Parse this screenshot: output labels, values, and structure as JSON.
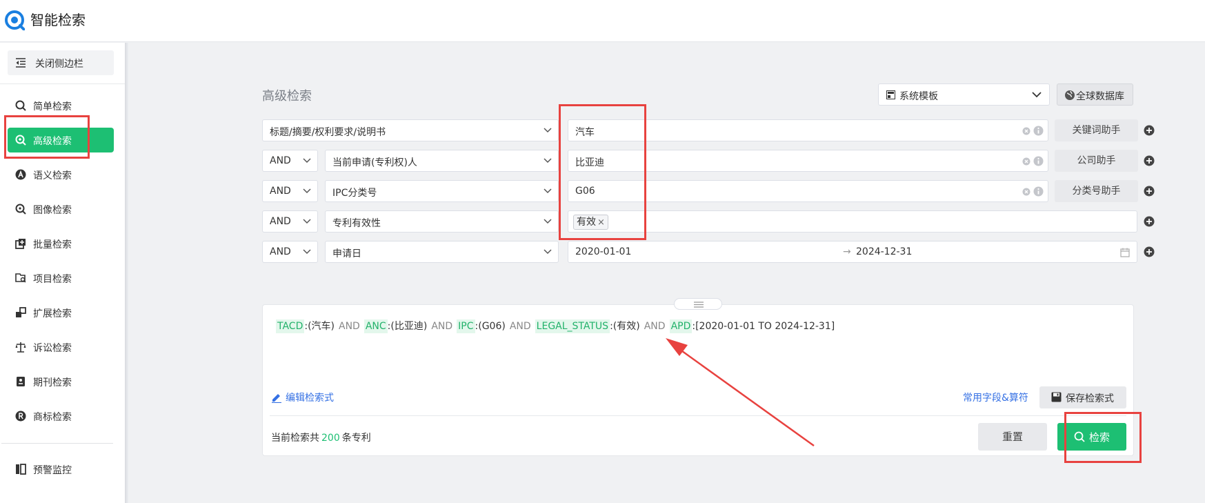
{
  "header": {
    "app_title": "智能检索",
    "logo_icon": "magnifier-logo-icon",
    "brand_color": "#1a7fe0"
  },
  "sidebar": {
    "collapse_label": "关闭侧边栏",
    "items": [
      {
        "label": "简单检索",
        "icon": "search-icon",
        "active": false
      },
      {
        "label": "高级检索",
        "icon": "advanced-search-icon",
        "active": true
      },
      {
        "label": "语义检索",
        "icon": "semantic-icon",
        "active": false
      },
      {
        "label": "图像检索",
        "icon": "image-search-icon",
        "active": false
      },
      {
        "label": "批量检索",
        "icon": "batch-icon",
        "active": false
      },
      {
        "label": "项目检索",
        "icon": "project-icon",
        "active": false
      },
      {
        "label": "扩展检索",
        "icon": "extend-icon",
        "active": false
      },
      {
        "label": "诉讼检索",
        "icon": "scale-icon",
        "active": false
      },
      {
        "label": "期刊检索",
        "icon": "journal-icon",
        "active": false
      },
      {
        "label": "商标检索",
        "icon": "trademark-icon",
        "active": false
      },
      {
        "label": "预警监控",
        "icon": "monitor-icon",
        "active": false
      }
    ],
    "active_color": "#1dbf73"
  },
  "main": {
    "title": "高级检索",
    "template_select": "系统模板",
    "database_button": "全球数据库",
    "rows": [
      {
        "operator": "",
        "field": "标题/摘要/权利要求/说明书",
        "value": "汽车",
        "helper": "关键词助手"
      },
      {
        "operator": "AND",
        "field": "当前申请(专利权)人",
        "value": "比亚迪",
        "helper": "公司助手"
      },
      {
        "operator": "AND",
        "field": "IPC分类号",
        "value": "G06",
        "helper": "分类号助手"
      },
      {
        "operator": "AND",
        "field": "专利有效性",
        "tag": "有效"
      },
      {
        "operator": "AND",
        "field": "申请日",
        "date_from": "2020-01-01",
        "date_to": "2024-12-31"
      }
    ],
    "query": {
      "parts": [
        {
          "field": "TACD",
          "value": ":(汽车)"
        },
        {
          "op": "AND"
        },
        {
          "field": "ANC",
          "value": ":(比亚迪)"
        },
        {
          "op": "AND"
        },
        {
          "field": "IPC",
          "value": ":(G06)"
        },
        {
          "op": "AND"
        },
        {
          "field": "LEGAL_STATUS",
          "value": ":(有效)"
        },
        {
          "op": "AND"
        },
        {
          "field": "APD",
          "value": ":[2020-01-01 TO 2024-12-31]"
        }
      ],
      "edit_label": "编辑检索式",
      "common_fields_label": "常用字段&算符",
      "save_label": "保存检索式",
      "count_prefix": "当前检索共",
      "count_value": "200",
      "count_suffix": "条专利",
      "reset_label": "重置",
      "search_label": "检索"
    }
  },
  "annotation_color": "#e8423f"
}
